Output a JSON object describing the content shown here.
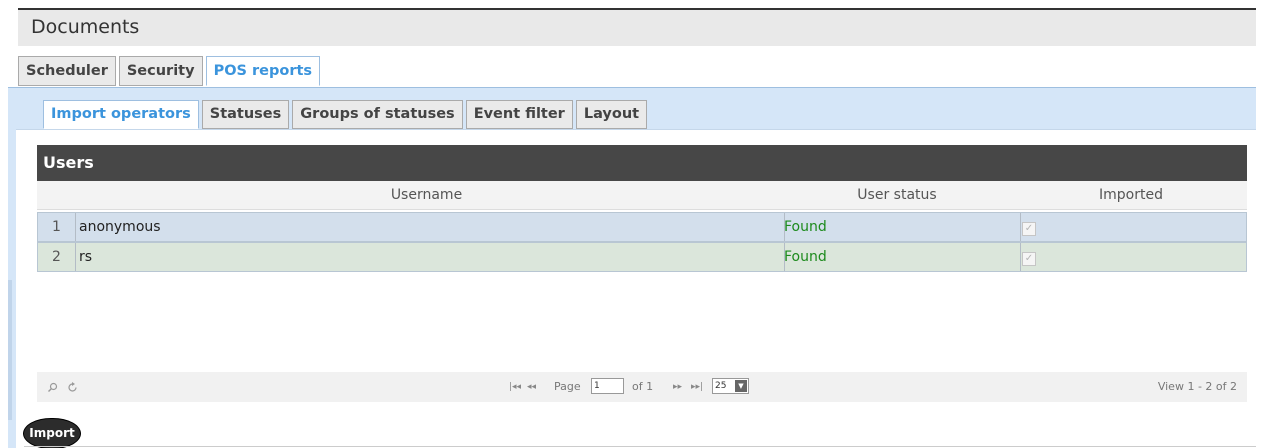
{
  "window": {
    "title": "Documents"
  },
  "tabs": [
    {
      "label": "Scheduler",
      "active": false
    },
    {
      "label": "Security",
      "active": false
    },
    {
      "label": "POS reports",
      "active": true
    }
  ],
  "subtabs": [
    {
      "label": "Import operators",
      "active": true
    },
    {
      "label": "Statuses",
      "active": false
    },
    {
      "label": "Groups of statuses",
      "active": false
    },
    {
      "label": "Event filter",
      "active": false
    },
    {
      "label": "Layout",
      "active": false
    }
  ],
  "grid": {
    "caption": "Users",
    "columns": {
      "username": "Username",
      "user_status": "User status",
      "imported": "Imported"
    },
    "rows": [
      {
        "num": "1",
        "username": "anonymous",
        "status": "Found",
        "imported": true
      },
      {
        "num": "2",
        "username": "rs",
        "status": "Found",
        "imported": true
      }
    ]
  },
  "pager": {
    "search_icon": "search-icon",
    "refresh_icon": "refresh-icon",
    "first_icon": "first-page-icon",
    "prev_icon": "prev-page-icon",
    "next_icon": "next-page-icon",
    "last_icon": "last-page-icon",
    "page_label": "Page",
    "page_value": "1",
    "of_label": "of 1",
    "rows_per_page": "25",
    "view_text": "View 1 - 2 of 2"
  },
  "actions": {
    "import_label": "Import"
  },
  "colors": {
    "active_tab": "#3b94dc",
    "status_found": "#1c8a1c",
    "caption_bg": "#474747",
    "panel_bg": "#d5e6f8"
  }
}
